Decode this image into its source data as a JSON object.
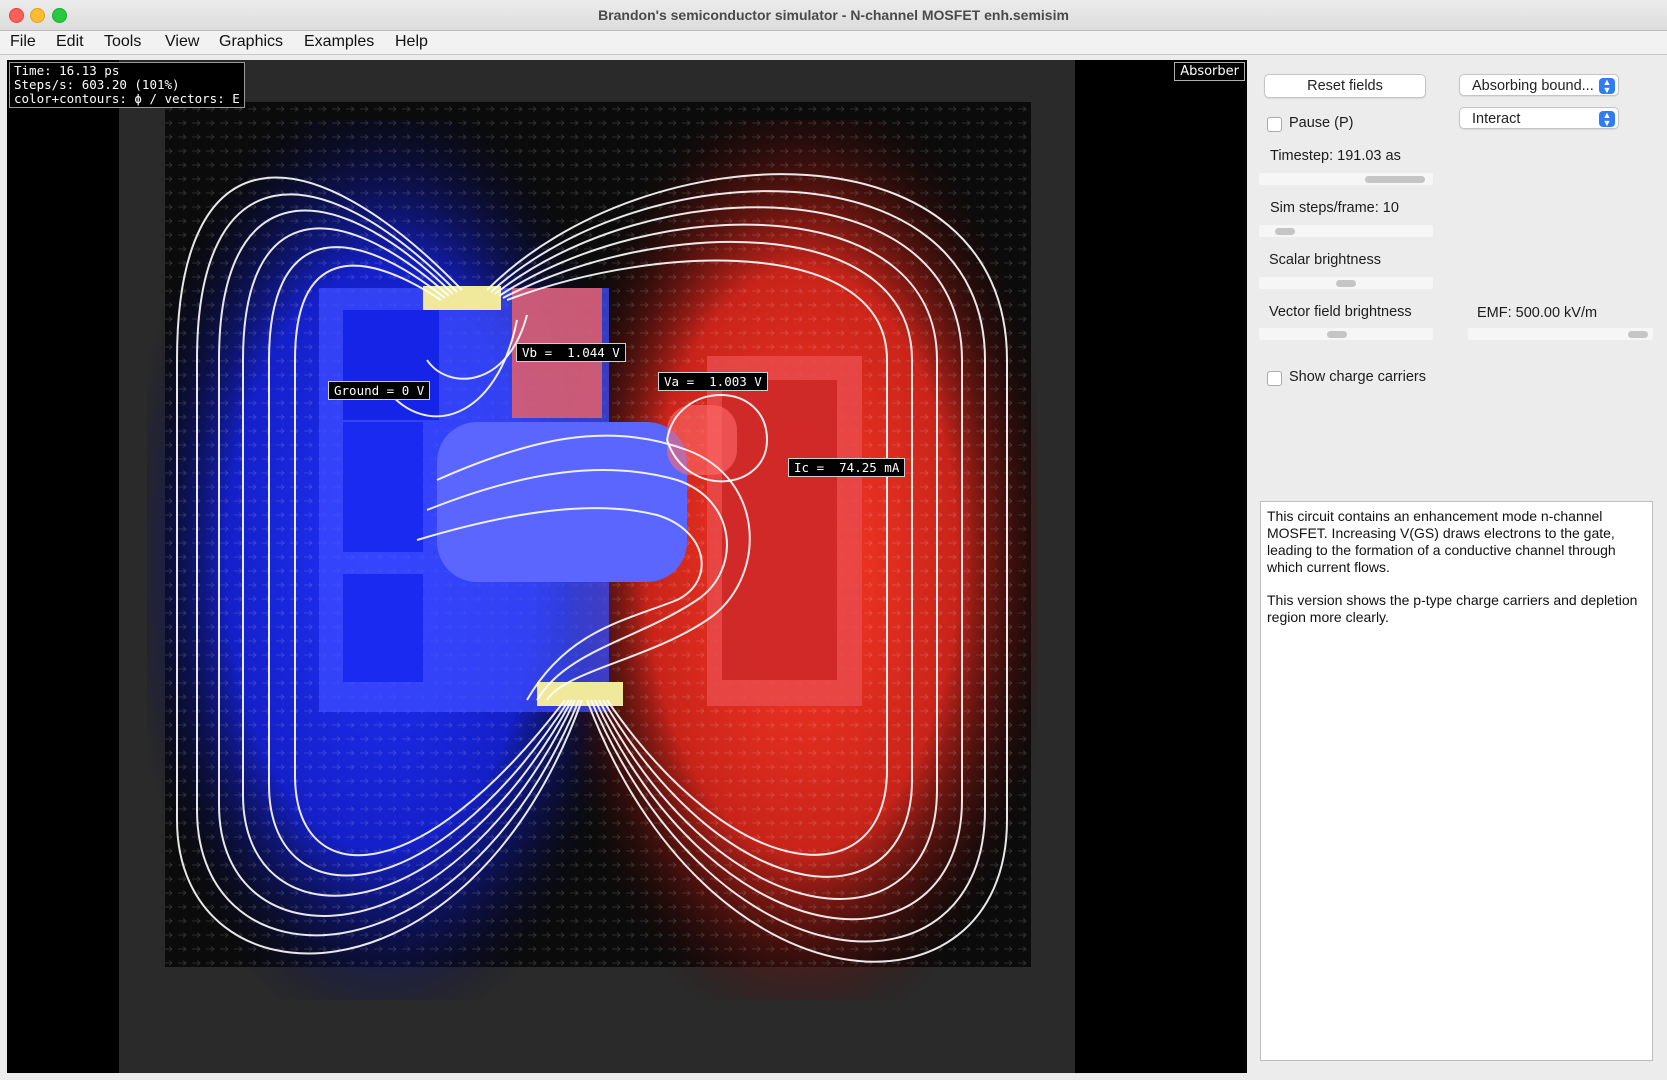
{
  "window": {
    "title": "Brandon's semiconductor simulator - N-channel MOSFET enh.semisim"
  },
  "menu": {
    "items": [
      "File",
      "Edit",
      "Tools",
      "View",
      "Graphics",
      "Examples",
      "Help"
    ]
  },
  "sim": {
    "info_lines": [
      "Time: 16.13 ps",
      "Steps/s: 603.20  (101%)",
      "color+contours: ϕ / vectors: E"
    ],
    "absorber_label": "Absorber",
    "probes": {
      "vb": "Vb =  1.044 V",
      "va": "Va =  1.003 V",
      "ground": "Ground = 0 V",
      "ic": "Ic =  74.25 mA"
    },
    "colors": {
      "negative": "#1a2cff",
      "positive": "#ff3a26",
      "contour": "#ffffff",
      "terminal": "#f0e89a"
    }
  },
  "panel": {
    "reset_button": "Reset fields",
    "boundary_select": "Absorbing bound...",
    "mode_select": "Interact",
    "pause_label": "Pause (P)",
    "pause_checked": false,
    "timestep_label": "Timestep: 191.03 as",
    "steps_label": "Sim steps/frame: 10",
    "scalar_label": "Scalar brightness",
    "vector_label": "Vector field brightness",
    "emf_label": "EMF: 500.00 kV/m",
    "show_carriers_label": "Show charge carriers",
    "show_carriers_checked": false,
    "sliders": {
      "timestep": 0.78,
      "steps": 0.15,
      "scalar": 0.5,
      "vector": 0.45,
      "emf": 0.92
    },
    "description": [
      "This circuit contains an enhancement mode n-channel MOSFET. Increasing V(GS) draws electrons to the gate, leading to the formation of a conductive channel through which current flows.",
      "This version shows the p-type charge carriers and depletion region more clearly."
    ]
  }
}
